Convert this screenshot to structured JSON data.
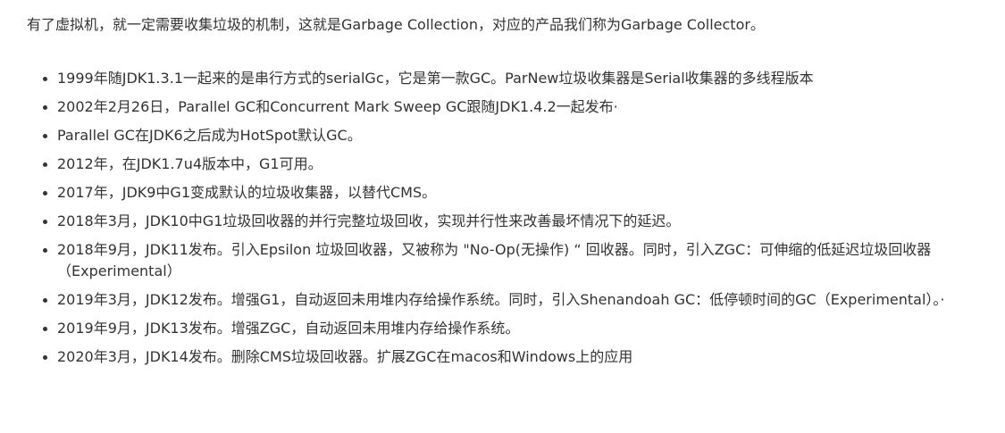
{
  "intro": "有了虚拟机，就一定需要收集垃圾的机制，这就是Garbage Collection，对应的产品我们称为Garbage Collector。",
  "items": [
    "1999年随JDK1.3.1一起来的是串行方式的serialGc，它是第一款GC。ParNew垃圾收集器是Serial收集器的多线程版本",
    "2002年2月26日，Parallel GC和Concurrent Mark Sweep GC跟随JDK1.4.2一起发布·",
    "Parallel GC在JDK6之后成为HotSpot默认GC。",
    "2012年，在JDK1.7u4版本中，G1可用。",
    "2017年，JDK9中G1变成默认的垃圾收集器，以替代CMS。",
    "2018年3月，JDK10中G1垃圾回收器的并行完整垃圾回收，实现并行性来改善最坏情况下的延迟。",
    "2018年9月，JDK11发布。引入Epsilon 垃圾回收器，又被称为 \"No-Op(无操作) “ 回收器。同时，引入ZGC：可伸缩的低延迟垃圾回收器（Experimental）",
    "2019年3月，JDK12发布。增强G1，自动返回未用堆内存给操作系统。同时，引入Shenandoah GC：低停顿时间的GC（Experimental）。·",
    "2019年9月，JDK13发布。增强ZGC，自动返回未用堆内存给操作系统。",
    "2020年3月，JDK14发布。删除CMS垃圾回收器。扩展ZGC在macos和Windows上的应用"
  ]
}
